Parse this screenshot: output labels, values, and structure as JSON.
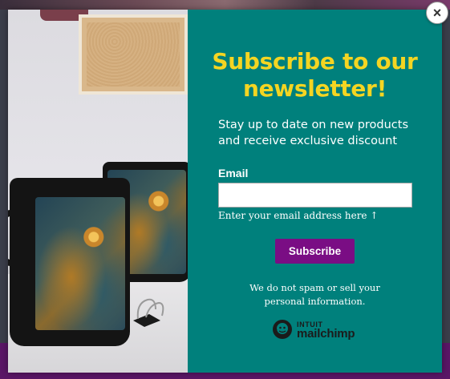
{
  "modal": {
    "close_label": "×",
    "title": "Subscribe to our newsletter!",
    "description": "Stay up to date on new products and receive exclusive discount",
    "email": {
      "label": "Email",
      "value": "",
      "placeholder": "",
      "hint": "Enter your email address here ↑"
    },
    "subscribe_label": "Subscribe",
    "disclaimer": "We do not spam or sell your personal information.",
    "brand": {
      "small": "INTUIT",
      "big": "mailchimp",
      "icon": "mailchimp-freddie-icon"
    }
  },
  "colors": {
    "panel_bg": "#00807c",
    "title": "#f4d522",
    "button_bg": "#7a0d84",
    "bottom_bar": "#5a1666"
  }
}
